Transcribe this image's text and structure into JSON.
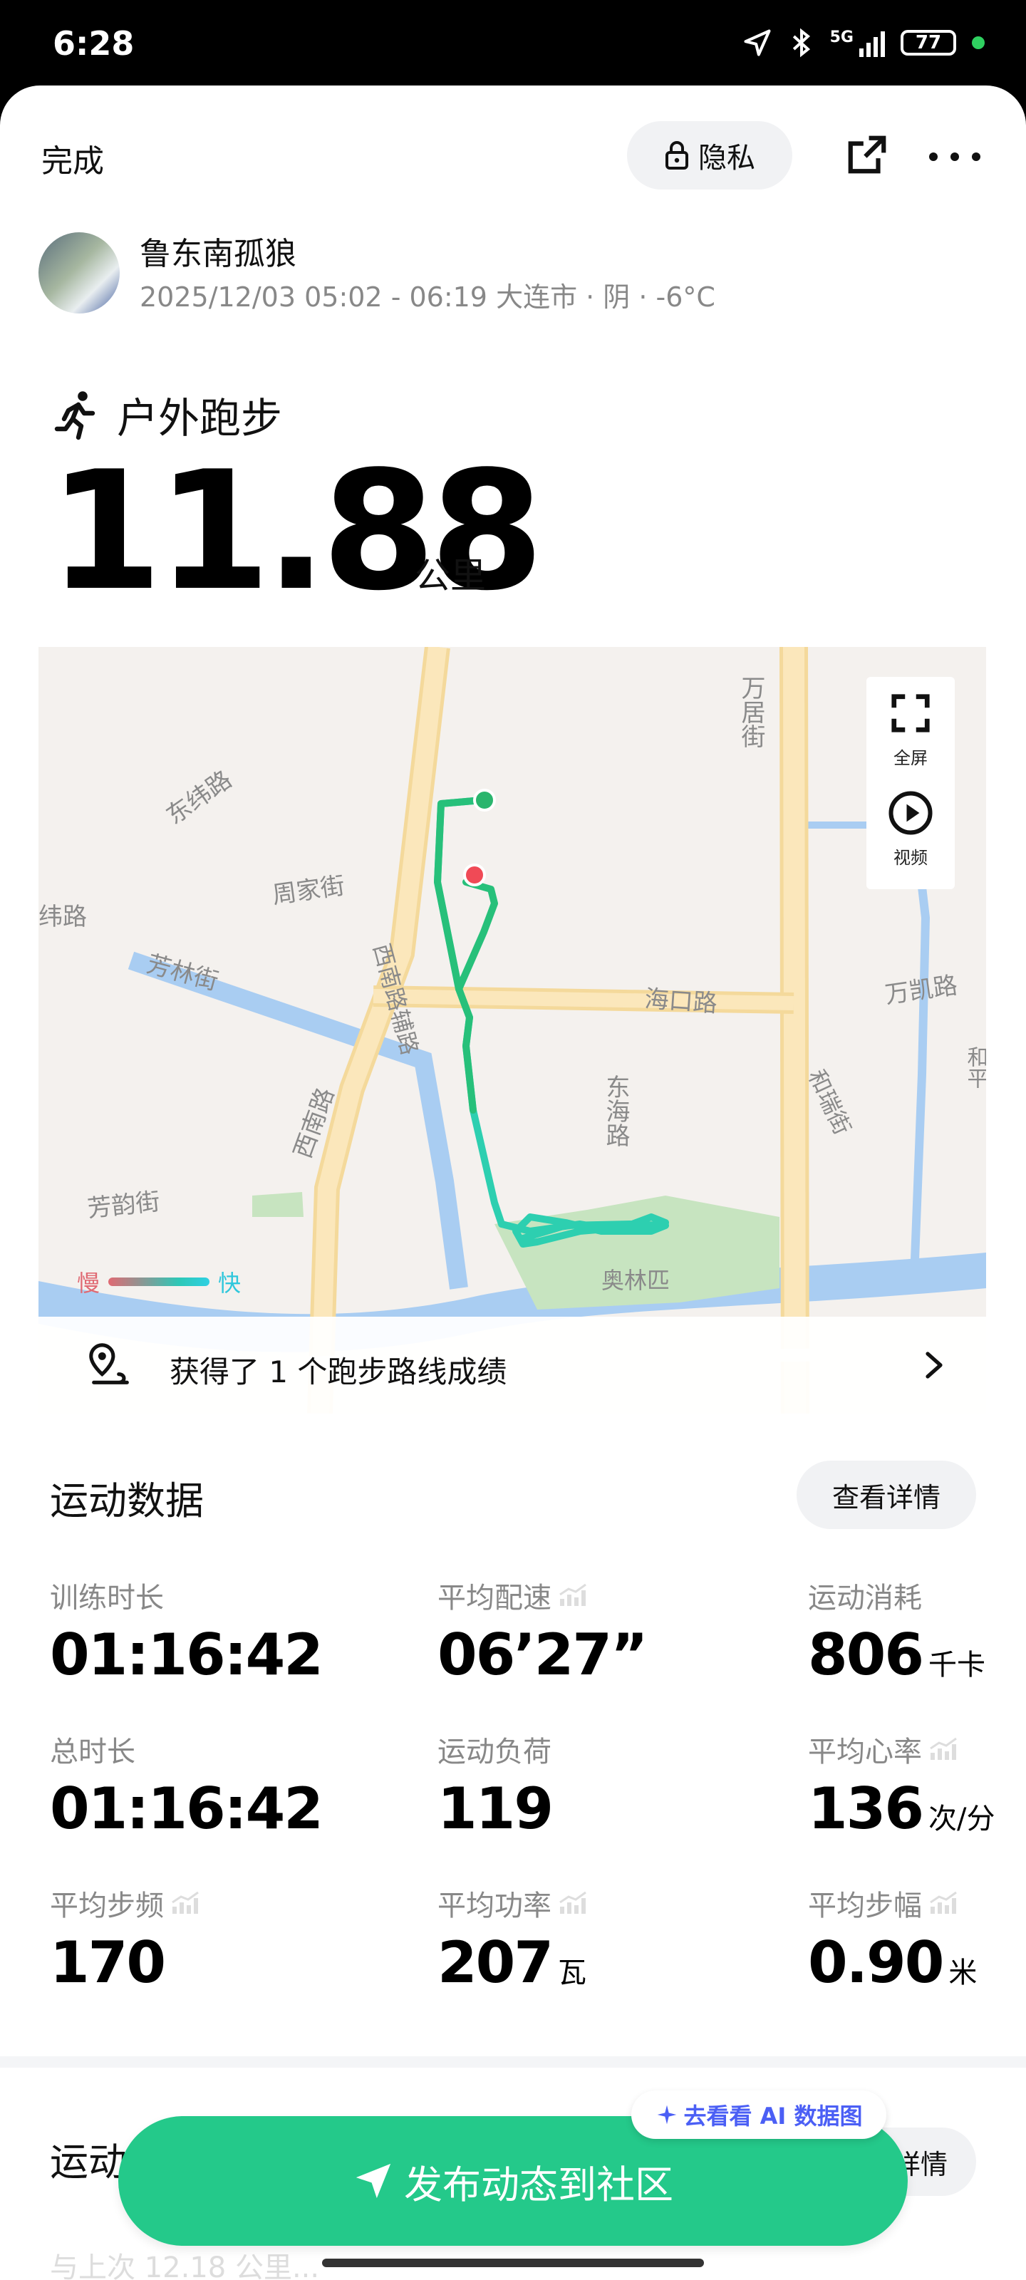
{
  "status": {
    "time": "6:28",
    "network": "5G",
    "battery": "77"
  },
  "topbar": {
    "done": "完成",
    "privacy": "隐私"
  },
  "user": {
    "name": "鲁东南孤狼",
    "meta": "2025/12/03 05:02 - 06:19 大连市 · 阴 · -6°C"
  },
  "sport": {
    "type": "户外跑步",
    "distance": "11.88",
    "unit": "公里"
  },
  "map": {
    "fullscreen": "全屏",
    "video": "视频",
    "legend_slow": "慢",
    "legend_fast": "快",
    "route_achievement": "获得了 1 个跑步路线成绩",
    "labels": {
      "dongwei": "东纬路",
      "wanju": "万居街",
      "zhoujia": "周家街",
      "wei": "纬路",
      "fanglin": "芳林街",
      "xinanfulu": "西南路辅路",
      "haikou": "海口路",
      "donghai": "东海路",
      "wankai": "万凯路",
      "herui": "和瑞街",
      "xinan": "西南路",
      "fangyun": "芳韵街",
      "aoti": "奥林匹",
      "edge": "和平"
    }
  },
  "stats": {
    "title": "运动数据",
    "detail": "查看详情",
    "items": [
      {
        "label": "训练时长",
        "value": "01:16:42",
        "unit": ""
      },
      {
        "label": "平均配速",
        "value": "06’27”",
        "unit": ""
      },
      {
        "label": "运动消耗",
        "value": "806",
        "unit": "千卡"
      },
      {
        "label": "总时长",
        "value": "01:16:42",
        "unit": ""
      },
      {
        "label": "运动负荷",
        "value": "119",
        "unit": ""
      },
      {
        "label": "平均心率",
        "value": "136",
        "unit": "次/分"
      },
      {
        "label": "平均步频",
        "value": "170",
        "unit": ""
      },
      {
        "label": "平均功率",
        "value": "207",
        "unit": "瓦"
      },
      {
        "label": "平均步幅",
        "value": "0.90",
        "unit": "米"
      }
    ]
  },
  "section2": {
    "title": "运动",
    "detail": "详情",
    "faded": "与上次 12.18 公里..."
  },
  "cta": {
    "label": "发布动态到社区",
    "ai_badge": "去看看 AI 数据图"
  },
  "colors": {
    "primary": "#24c98a",
    "route": "#2dc8a0",
    "ai": "#4b5ff5"
  }
}
